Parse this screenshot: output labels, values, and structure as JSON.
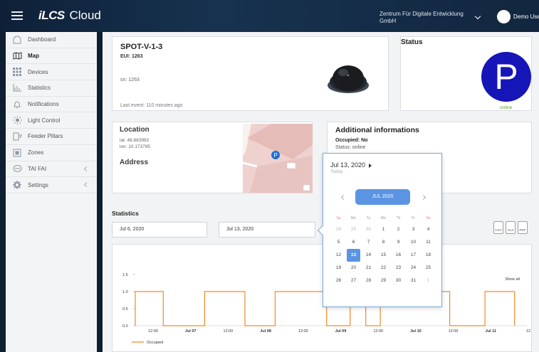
{
  "topbar": {
    "brand_logo": "iLCS",
    "brand_name": "Cloud",
    "org_line1": "Zentrum Für Digitale Entwicklung",
    "org_line2": "GmbH",
    "username": "Demo User"
  },
  "sidebar": {
    "items": [
      {
        "label": "Dashboard",
        "icon": "dashboard-icon"
      },
      {
        "label": "Map",
        "icon": "map-icon"
      },
      {
        "label": "Devices",
        "icon": "devices-icon"
      },
      {
        "label": "Statistics",
        "icon": "statistics-icon"
      },
      {
        "label": "Notifications",
        "icon": "bell-icon"
      },
      {
        "label": "Light Control",
        "icon": "light-icon"
      },
      {
        "label": "Feeder Pillars",
        "icon": "feeder-icon"
      },
      {
        "label": "Zones",
        "icon": "zones-icon"
      },
      {
        "label": "TAI FAI",
        "icon": "taifai-icon"
      },
      {
        "label": "Settings",
        "icon": "gear-icon"
      }
    ]
  },
  "device": {
    "title": "SPOT-V-1-3",
    "eui": "EUI: 1263",
    "sn": "sn: 1263",
    "last_event": "Last event: 110 minutes ago"
  },
  "status": {
    "title": "Status",
    "letter": "P",
    "state": "online",
    "circle_color": "#1515b8",
    "state_color": "#5aa02c"
  },
  "location": {
    "title": "Location",
    "lat": "lat: 48.883992",
    "lon": "lon: 10.173795",
    "address_title": "Address",
    "map_marker": "P"
  },
  "additional": {
    "title": "Additional informations",
    "occupied": "Occupied: No",
    "status": "Status: online"
  },
  "statistics": {
    "title": "Statistics",
    "date_from": "Jul 6, 2020",
    "date_to": "Jul 13, 2020",
    "export": [
      "CSV",
      "XLS",
      "PDF"
    ]
  },
  "datepicker": {
    "header": "Jul 13, 2020",
    "today_label": "Today",
    "month_label": "JUL 2020",
    "weekdays": [
      "Su",
      "Mo",
      "Tu",
      "We",
      "Th",
      "Fr",
      "Sa"
    ],
    "weeks": [
      [
        "28",
        "29",
        "30",
        "1",
        "2",
        "3",
        "4"
      ],
      [
        "5",
        "6",
        "7",
        "8",
        "9",
        "10",
        "11"
      ],
      [
        "12",
        "13",
        "14",
        "15",
        "16",
        "17",
        "18"
      ],
      [
        "19",
        "20",
        "21",
        "22",
        "23",
        "24",
        "25"
      ],
      [
        "26",
        "27",
        "28",
        "29",
        "30",
        "31",
        "1"
      ]
    ],
    "selected": "13",
    "accent": "#5b94e3"
  },
  "chart_data": {
    "type": "line",
    "series": [
      {
        "name": "Occupied",
        "color": "#f08a24"
      }
    ],
    "x_ticks": [
      "12:00",
      "Jul 07",
      "12:00",
      "Jul 08",
      "12:00",
      "Jul 09",
      "12:00",
      "Jul 10",
      "12:00",
      "Jul 11",
      "12"
    ],
    "y_ticks": [
      "1.5",
      "1.0",
      "0.5",
      "0.0"
    ],
    "ylim": [
      0,
      1.5
    ],
    "show_all_label": "Show all",
    "step_x": [
      0,
      0,
      0.5,
      0.5,
      1.24,
      1.24,
      1.96,
      1.96,
      2.5,
      2.5,
      3.42,
      3.42,
      3.84,
      3.84,
      4.12,
      4.12,
      4.38,
      4.38,
      5.62,
      5.62,
      6.25,
      6.25,
      6.78,
      6.78
    ],
    "step_y": [
      0,
      1,
      1,
      0,
      0,
      1,
      1,
      0,
      0,
      1,
      1,
      0,
      0,
      1,
      1,
      0,
      0,
      1,
      1,
      0,
      0,
      1,
      1,
      0
    ],
    "x_range": [
      0,
      7.0
    ]
  }
}
